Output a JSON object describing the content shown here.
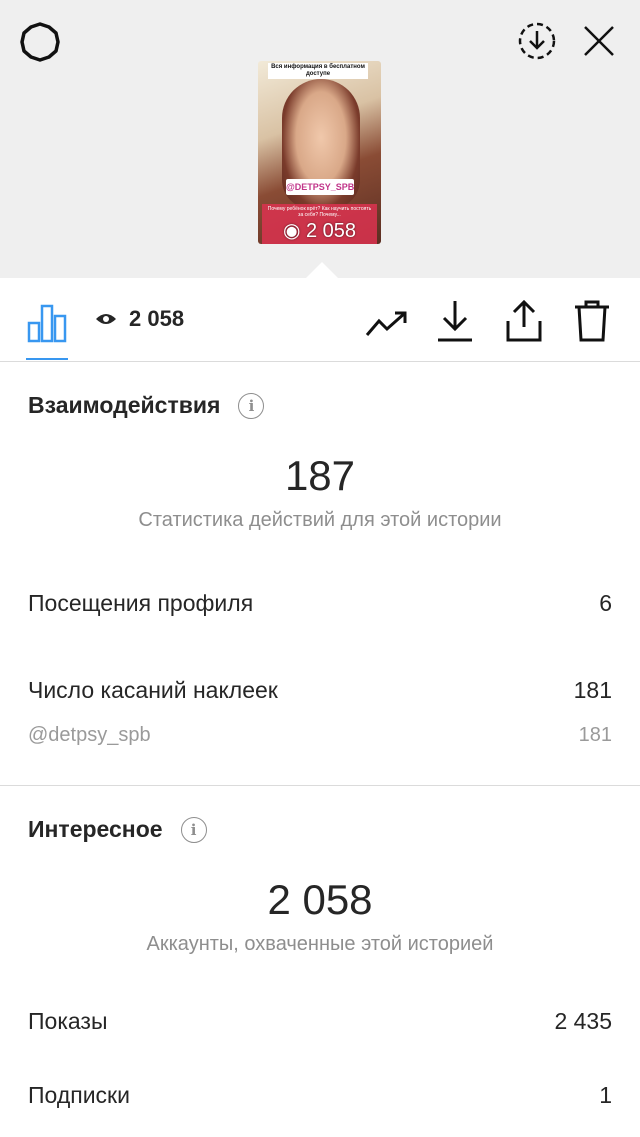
{
  "story_preview": {
    "top_text": "Вся информация в бесплатном доступе",
    "sticker_mention": "@DETPSY_SPB",
    "question_text": "Почему ребёнок врёт? Как научить постоять за себя? Почему...",
    "views_overlay": "2 058"
  },
  "toolbar": {
    "views_count": "2 058"
  },
  "interactions": {
    "title": "Взаимодействия",
    "total_value": "187",
    "total_caption": "Статистика действий для этой истории",
    "profile_visits_label": "Посещения профиля",
    "profile_visits_value": "6",
    "sticker_taps_label": "Число касаний наклеек",
    "sticker_taps_value": "181",
    "sticker_account_label": "@detpsy_spb",
    "sticker_account_value": "181"
  },
  "discovery": {
    "title": "Интересное",
    "accounts_reached_value": "2 058",
    "accounts_reached_caption": "Аккаунты, охваченные этой историей",
    "impressions_label": "Показы",
    "impressions_value": "2 435",
    "follows_label": "Подписки",
    "follows_value": "1"
  },
  "icons": {
    "settings": "gear-icon",
    "save_story": "download-circle-icon",
    "close": "close-icon",
    "insights_tab": "bar-chart-icon",
    "eye": "eye-icon",
    "promote": "trending-up-icon",
    "download": "download-icon",
    "share": "share-icon",
    "delete": "trash-icon",
    "info": "info-icon"
  },
  "colors": {
    "accent": "#3897f0",
    "muted_text": "#8e8e8e",
    "top_background": "#efefef"
  }
}
